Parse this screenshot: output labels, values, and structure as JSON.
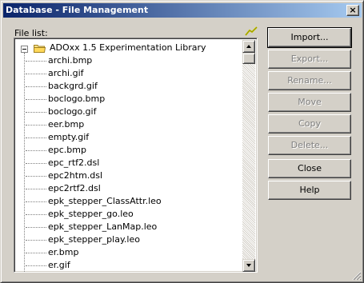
{
  "window": {
    "title": "Database - File Management",
    "close_label": "×"
  },
  "file_list": {
    "label": "File list:",
    "root_folder": "ADOxx 1.5 Experimentation Library",
    "files": [
      "archi.bmp",
      "archi.gif",
      "backgrd.gif",
      "boclogo.bmp",
      "boclogo.gif",
      "eer.bmp",
      "empty.gif",
      "epc.bmp",
      "epc_rtf2.dsl",
      "epc2htm.dsl",
      "epc2rtf2.dsl",
      "epk_stepper_ClassAttr.leo",
      "epk_stepper_go.leo",
      "epk_stepper_LanMap.leo",
      "epk_stepper_play.leo",
      "er.bmp",
      "er.gif"
    ]
  },
  "buttons": [
    {
      "label": "Import...",
      "enabled": true,
      "default": true
    },
    {
      "label": "Export...",
      "enabled": false,
      "default": false
    },
    {
      "label": "Rename...",
      "enabled": false,
      "default": false
    },
    {
      "label": "Move",
      "enabled": false,
      "default": false
    },
    {
      "label": "Copy",
      "enabled": false,
      "default": false
    },
    {
      "label": "Delete...",
      "enabled": false,
      "default": false
    },
    {
      "label": "Close",
      "enabled": true,
      "default": false
    },
    {
      "label": "Help",
      "enabled": true,
      "default": false
    }
  ],
  "icons": {
    "refresh": "flash-icon",
    "folder": "folder-icon",
    "expander": "minus-box-icon"
  },
  "colors": {
    "titlebar_start": "#0a246a",
    "titlebar_end": "#a6caf0",
    "dialog_bg": "#d4d0c8",
    "disabled_text": "#808080"
  }
}
